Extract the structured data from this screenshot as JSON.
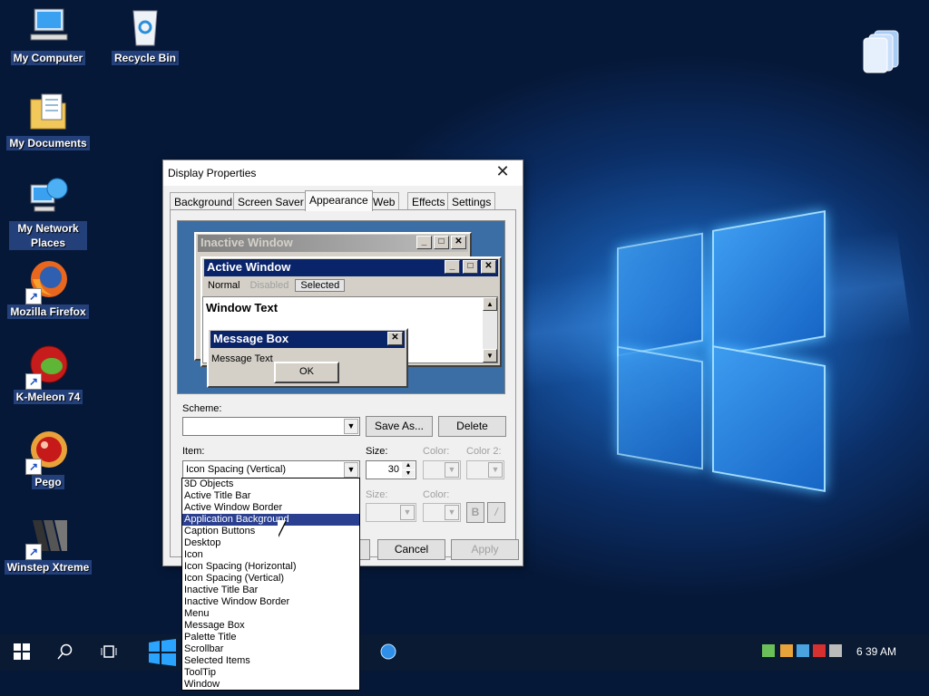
{
  "desktop": {
    "icons": [
      {
        "label": "My Computer"
      },
      {
        "label": "Recycle Bin"
      },
      {
        "label": "My Documents"
      },
      {
        "label": "My Network Places"
      },
      {
        "label": "Mozilla Firefox"
      },
      {
        "label": "K-Meleon 74"
      },
      {
        "label": "Pego"
      },
      {
        "label": "Winstep Xtreme"
      }
    ]
  },
  "dialog": {
    "title": "Display Properties",
    "tabs": [
      "Background",
      "Screen Saver",
      "Appearance",
      "Web",
      "Effects",
      "Settings"
    ],
    "active_tab": "Appearance",
    "preview": {
      "inactive_title": "Inactive Window",
      "active_title": "Active Window",
      "menu": [
        "Normal",
        "Disabled",
        "Selected"
      ],
      "window_text": "Window Text",
      "msgbox_title": "Message Box",
      "msgbox_text": "Message Text",
      "msgbox_ok": "OK"
    },
    "scheme_label": "Scheme:",
    "scheme_value": "",
    "save_as": "Save As...",
    "delete": "Delete",
    "item_label": "Item:",
    "item_value": "Icon Spacing (Vertical)",
    "size_label": "Size:",
    "size_value": "30",
    "color_label": "Color:",
    "color2_label": "Color 2:",
    "font_size_label": "Size:",
    "font_color_label": "Color:",
    "bold": "B",
    "italic": "/",
    "cancel": "Cancel",
    "apply": "Apply",
    "item_options": [
      "3D Objects",
      "Active Title Bar",
      "Active Window Border",
      "Application Background",
      "Caption Buttons",
      "Desktop",
      "Icon",
      "Icon Spacing (Horizontal)",
      "Icon Spacing (Vertical)",
      "Inactive Title Bar",
      "Inactive Window Border",
      "Menu",
      "Message Box",
      "Palette Title",
      "Scrollbar",
      "Selected Items",
      "ToolTip",
      "Window"
    ],
    "highlighted_option": "Application Background"
  },
  "taskbar": {
    "clock": "6 39 AM"
  },
  "colors": {
    "active_title": "#0a246a",
    "inactive_title": "#808080",
    "preview_bg": "#3a6ea5",
    "selection": "#2a3f8f"
  }
}
